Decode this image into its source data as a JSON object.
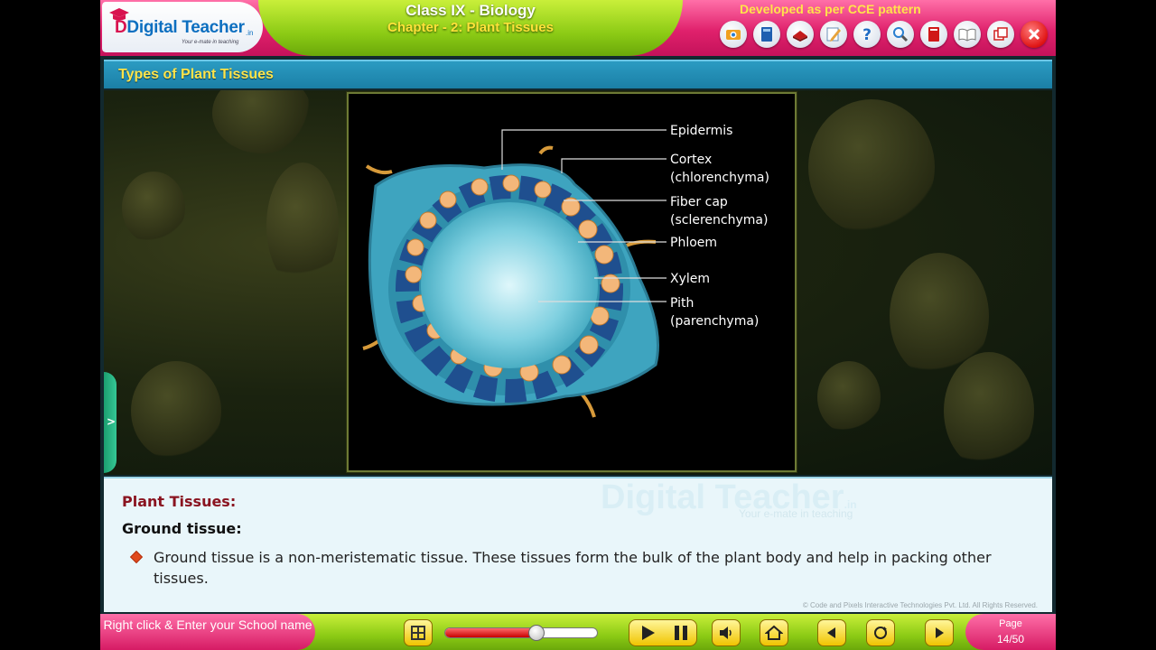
{
  "header": {
    "brand": "Digital Teacher",
    "brand_suffix": ".in",
    "tagline": "Your e-mate in teaching",
    "title": "Class IX - Biology",
    "chapter": "Chapter - 2: Plant Tissues",
    "cce": "Developed as per CCE pattern",
    "tools": [
      "camera-icon",
      "book-icon",
      "notes-icon",
      "pencil-icon",
      "help-icon",
      "search-icon",
      "bookmark-icon",
      "open-book-icon",
      "window-icon",
      "close-icon"
    ]
  },
  "section": {
    "title": "Types of Plant Tissues"
  },
  "side_tab": {
    "label": ">"
  },
  "figure": {
    "labels": {
      "epidermis": "Epidermis",
      "cortex": "Cortex",
      "cortex_sub": "(chlorenchyma)",
      "fiber": "Fiber cap",
      "fiber_sub": "(sclerenchyma)",
      "phloem": "Phloem",
      "xylem": "Xylem",
      "pith": "Pith",
      "pith_sub": "(parenchyma)"
    }
  },
  "panel": {
    "heading": "Plant Tissues:",
    "subheading": "Ground tissue:",
    "body": "Ground tissue is a non-meristematic tissue. These tissues form the bulk of the plant body and help in packing other tissues.",
    "watermark": "Digital Teacher",
    "watermark_suffix": ".in",
    "watermark_tag": "Your e-mate in teaching",
    "copyright": "© Code and Pixels Interactive Technologies  Pvt. Ltd. All Rights Reserved."
  },
  "footer": {
    "school_prompt": "Right click & Enter your School name",
    "progress": 0.6,
    "page_label": "Page",
    "page_value": "14/50"
  },
  "colors": {
    "header_pink": "#e0216c",
    "header_green": "#8ccb15",
    "section_blue": "#1b7fa6",
    "accent_yellow": "#ffe44a"
  }
}
